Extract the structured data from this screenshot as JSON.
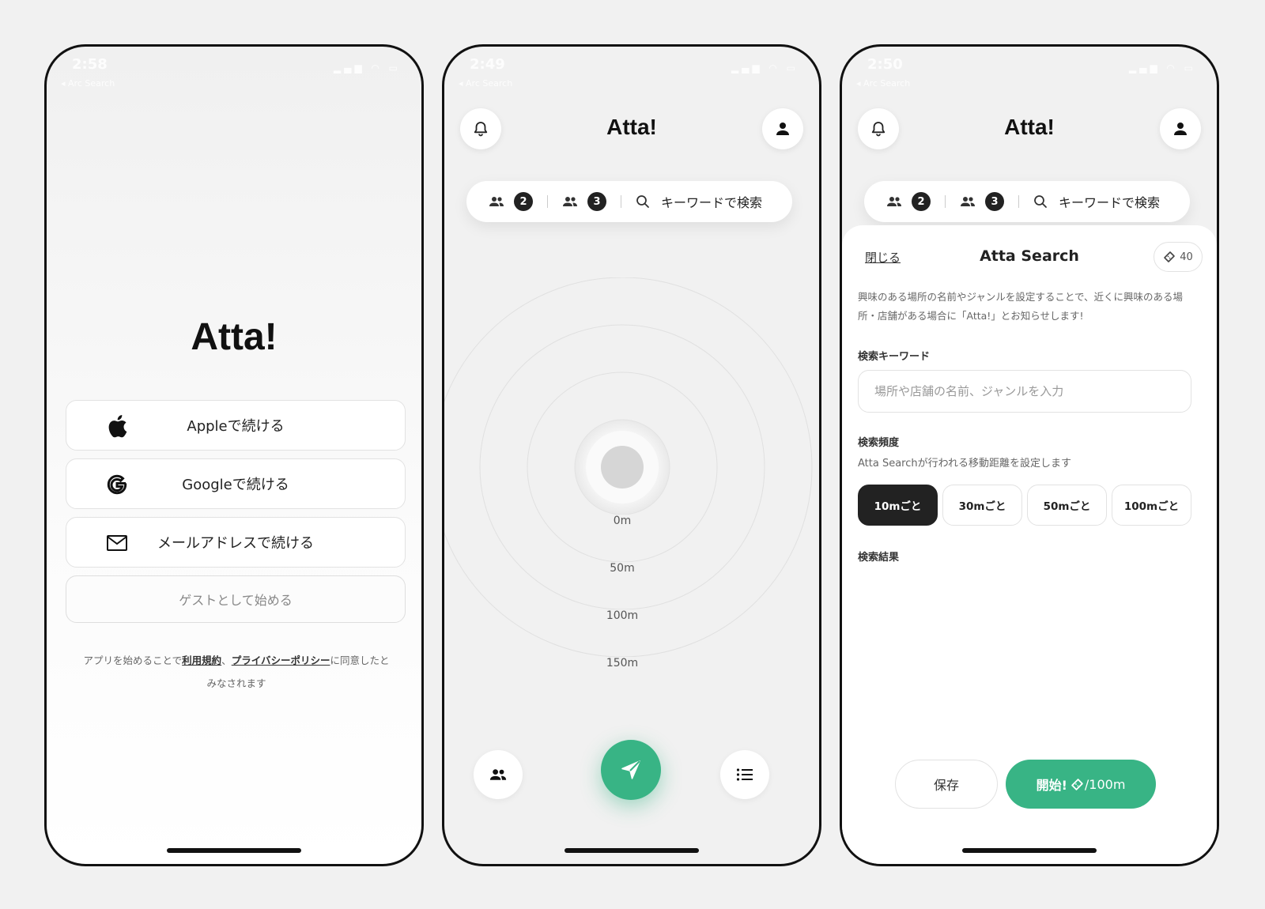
{
  "screen1": {
    "status": {
      "time": "2:58",
      "back": "◂ Arc Search"
    },
    "logo": "Atta!",
    "buttons": [
      {
        "label": "Appleで続ける",
        "icon": "apple-icon"
      },
      {
        "label": "Googleで続ける",
        "icon": "google-icon"
      },
      {
        "label": "メールアドレスで続ける",
        "icon": "mail-icon"
      }
    ],
    "guest_label": "ゲストとして始める",
    "terms": {
      "prefix": "アプリを始めることで",
      "terms_link": "利用規約",
      "sep": "、",
      "privacy_link": "プライバシーポリシー",
      "suffix_line1": "に同意したと",
      "suffix_line2": "みなされます"
    }
  },
  "screen2": {
    "status": {
      "time": "2:49",
      "back": "◂ Arc Search"
    },
    "title": "Atta!",
    "search_bar": {
      "group1_count": "2",
      "group2_count": "3",
      "placeholder": "キーワードで検索"
    },
    "radar_labels": [
      "0m",
      "50m",
      "100m",
      "150m"
    ],
    "accent": "#38b485"
  },
  "screen3": {
    "status": {
      "time": "2:50",
      "back": "◂ Arc Search"
    },
    "title": "Atta!",
    "search_bar": {
      "group1_count": "2",
      "group2_count": "3",
      "placeholder": "キーワードで検索"
    },
    "sheet": {
      "close": "閉じる",
      "title": "Atta Search",
      "ticket_count": "40",
      "description": "興味のある場所の名前やジャンルを設定することで、近くに興味のある場所・店舗がある場合に「Atta!」とお知らせします!",
      "keyword_label": "検索キーワード",
      "keyword_placeholder": "場所や店舗の名前、ジャンルを入力",
      "keyword_value": "",
      "frequency_label": "検索頻度",
      "frequency_desc": "Atta Searchが行われる移動距離を設定します",
      "frequency_options": [
        "10mごと",
        "30mごと",
        "50mごと",
        "100mごと"
      ],
      "frequency_selected": "10mごと",
      "results_label": "検索結果",
      "save_label": "保存",
      "start_label": "開始! ",
      "start_cost": "/100m"
    }
  }
}
